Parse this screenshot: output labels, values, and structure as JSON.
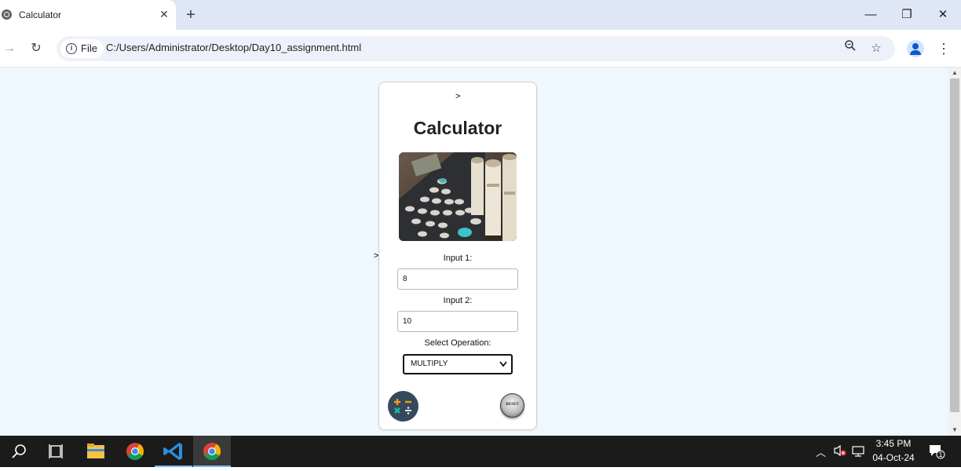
{
  "browser": {
    "tab_title": "Calculator",
    "tab_close": "✕",
    "new_tab": "+",
    "window_minimize": "—",
    "window_restore": "❐",
    "window_close": "✕",
    "address_chip": "File",
    "url": "C:/Users/Administrator/Desktop/Day10_assignment.html"
  },
  "page": {
    "stray_top": ">",
    "stray_left": ">",
    "title": "Calculator",
    "input1_label": "Input 1:",
    "input1_value": "8",
    "input2_label": "Input 2:",
    "input2_value": "10",
    "operation_label": "Select Operation:",
    "operation_selected": "MULTIPLY",
    "reset_label": "RESET",
    "calc_icon_glyphs": "+ − × ÷"
  },
  "taskbar": {
    "time": "3:45 PM",
    "date": "04-Oct-24",
    "notification_count": "1"
  },
  "colors": {
    "page_bg": "#f0f8ff",
    "calc_button": "#34495e",
    "calc_symbols": "#f39c12",
    "calc_symbols_alt": "#1abc9c"
  }
}
